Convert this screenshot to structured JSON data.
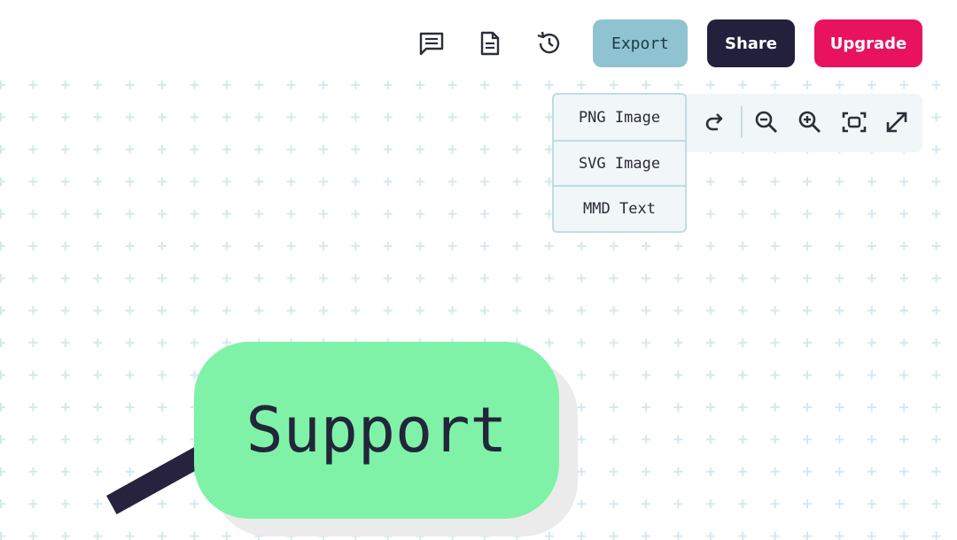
{
  "toolbar": {
    "export_label": "Export",
    "share_label": "Share",
    "upgrade_label": "Upgrade",
    "icons": [
      "comment-icon",
      "document-icon",
      "history-icon"
    ]
  },
  "export_menu": {
    "items": [
      {
        "label": "PNG Image"
      },
      {
        "label": "SVG Image"
      },
      {
        "label": "MMD Text"
      }
    ]
  },
  "zoom_toolbar": {
    "icons": [
      "redo-icon",
      "zoom-out-icon",
      "zoom-in-icon",
      "fit-screen-icon",
      "fullscreen-icon"
    ]
  },
  "canvas": {
    "node_label": "Support"
  },
  "colors": {
    "export_bg": "#8fc3d1",
    "share_bg": "#22203a",
    "upgrade_bg": "#e8125f",
    "node_bg": "#7ff2a8",
    "grid": "#d4e9ee"
  }
}
